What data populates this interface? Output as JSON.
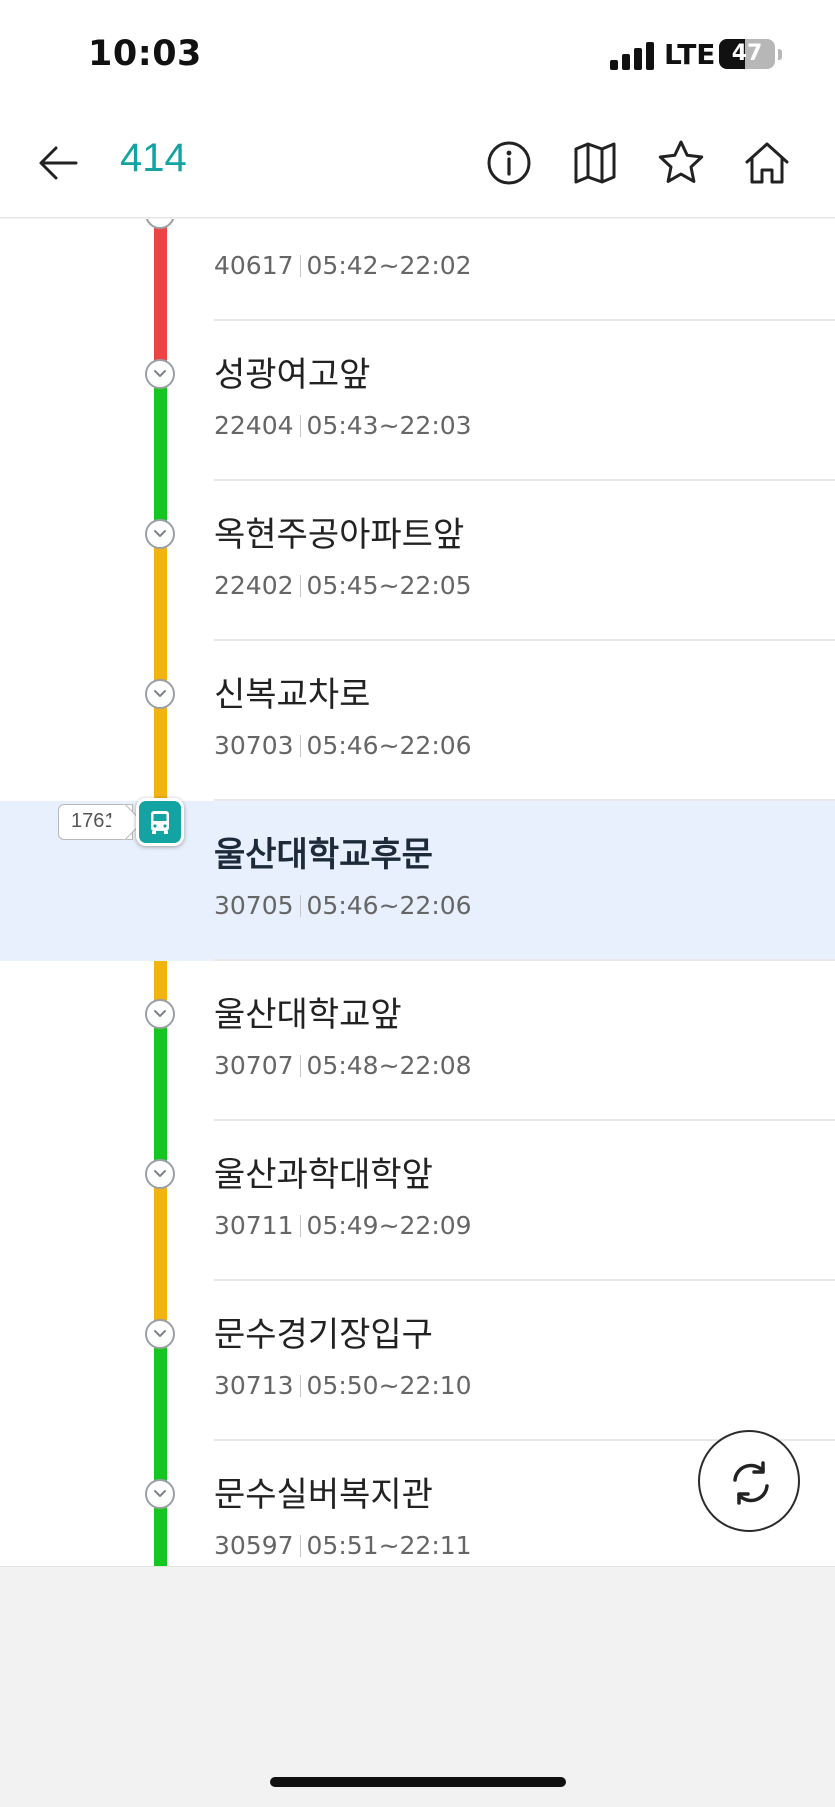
{
  "status_bar": {
    "time": "10:03",
    "network": "LTE",
    "battery_percent": "47",
    "battery_level": 0.47,
    "signal_bars": 4
  },
  "header": {
    "route_number": "414",
    "icons": [
      "back-arrow-icon",
      "info-icon",
      "map-icon",
      "star-icon",
      "home-icon"
    ]
  },
  "colors": {
    "accent": "#14a3a3",
    "green": "#12c71f",
    "red": "#ec4444",
    "yellow": "#f1b30c",
    "selected_bg": "#e8f0fd"
  },
  "stops": [
    {
      "name": "",
      "id": "40617",
      "hours": "05:42~22:02"
    },
    {
      "name": "성광여고앞",
      "id": "22404",
      "hours": "05:43~22:03"
    },
    {
      "name": "옥현주공아파트앞",
      "id": "22402",
      "hours": "05:45~22:05"
    },
    {
      "name": "신복교차로",
      "id": "30703",
      "hours": "05:46~22:06"
    },
    {
      "name": "울산대학교후문",
      "id": "30705",
      "hours": "05:46~22:06",
      "selected": true
    },
    {
      "name": "울산대학교앞",
      "id": "30707",
      "hours": "05:48~22:08"
    },
    {
      "name": "울산과학대학앞",
      "id": "30711",
      "hours": "05:49~22:09"
    },
    {
      "name": "문수경기장입구",
      "id": "30713",
      "hours": "05:50~22:10"
    },
    {
      "name": "문수실버복지관",
      "id": "30597",
      "hours": "05:51~22:11"
    }
  ],
  "route_segments": [
    "green",
    "red",
    "green",
    "yellow",
    "yellow",
    "yellow",
    "green",
    "yellow",
    "green"
  ],
  "bus": {
    "vehicle_number": "1761",
    "icon": "bus-icon"
  },
  "refresh": {
    "icon": "refresh-icon"
  }
}
